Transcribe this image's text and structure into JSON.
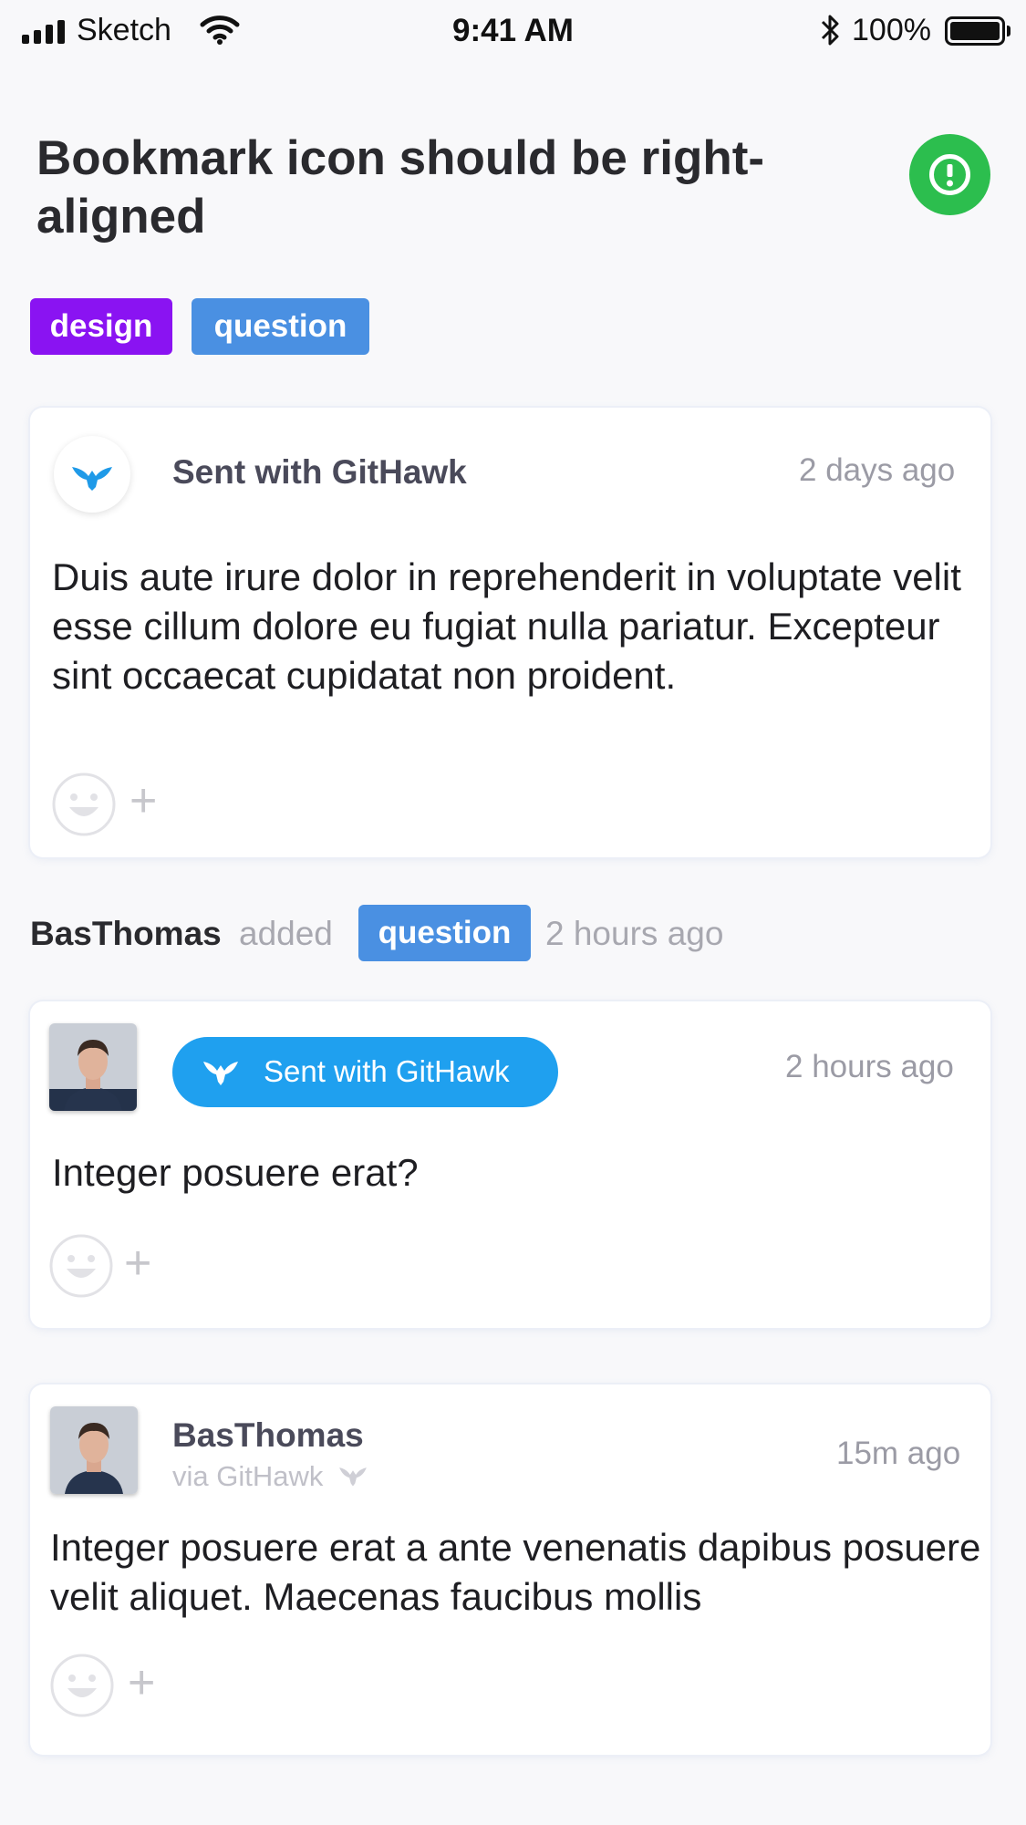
{
  "status_bar": {
    "carrier": "Sketch",
    "time": "9:41 AM",
    "battery": "100%"
  },
  "issue": {
    "title": "Bookmark icon should be right-aligned",
    "state_color": "#2cbe4e",
    "labels": [
      {
        "name": "design",
        "color": "#8a13f2"
      },
      {
        "name": "question",
        "color": "#4a90e2"
      }
    ]
  },
  "comments": [
    {
      "author": "Sent with GitHawk",
      "time": "2 days ago",
      "body": "Duis aute irure dolor in reprehenderit in voluptate velit esse cillum dolore eu fugiat nulla pariatur. Excepteur sint occaecat cupidatat non proident.",
      "avatar_icon": "githawk-bird-icon"
    },
    {
      "badge": "Sent with GitHawk",
      "time": "2 hours ago",
      "body": "Integer posuere erat?",
      "avatar_icon": "user-photo"
    },
    {
      "author": "BasThomas",
      "via": "via GitHawk",
      "time": "15m ago",
      "body": "Integer posuere erat a ante venenatis dapibus posuere velit aliquet. Maecenas faucibus mollis",
      "avatar_icon": "user-photo"
    }
  ],
  "event": {
    "user": "BasThomas",
    "action": "added",
    "label": "question",
    "label_color": "#4a90e2",
    "time": "2 hours ago"
  },
  "reactions": {
    "icon": "smiley-icon",
    "add": "+"
  }
}
